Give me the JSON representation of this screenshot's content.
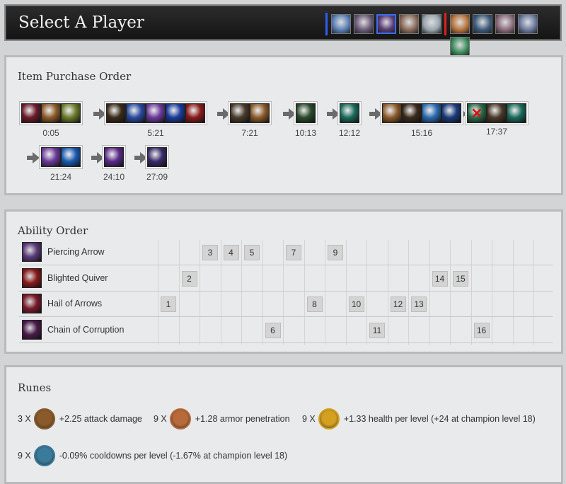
{
  "header": {
    "title": "Select A Player",
    "blue_team": [
      {
        "icon": "champion-portrait-blue-1",
        "color": "#5a7fb8"
      },
      {
        "icon": "champion-portrait-blue-2",
        "color": "#6a5a78"
      },
      {
        "icon": "champion-portrait-blue-3",
        "color": "#5a3d7a",
        "selected": true
      },
      {
        "icon": "champion-portrait-blue-4",
        "color": "#8a6a5a"
      },
      {
        "icon": "champion-portrait-blue-5",
        "color": "#9aa6b0"
      }
    ],
    "red_team": [
      {
        "icon": "champion-portrait-red-1",
        "color": "#b8723a"
      },
      {
        "icon": "champion-portrait-red-2",
        "color": "#3a5a7a"
      },
      {
        "icon": "champion-portrait-red-3",
        "color": "#8a6a7a"
      },
      {
        "icon": "champion-portrait-red-4",
        "color": "#6a7aa0"
      },
      {
        "icon": "champion-portrait-red-5",
        "color": "#3a8a5a"
      }
    ]
  },
  "items": {
    "title": "Item Purchase Order",
    "groups": [
      {
        "time": "0:05",
        "items": [
          "#6a1a2a",
          "#8a5a2a",
          "#6a7a2a"
        ]
      },
      {
        "time": "5:21",
        "items": [
          "#3a2a1a",
          "#2a4aa0",
          "#6a3a9a",
          "#1a3a9a",
          "#8a1a1a"
        ]
      },
      {
        "time": "7:21",
        "items": [
          "#4a3a2a",
          "#8a5a2a"
        ]
      },
      {
        "time": "10:13",
        "items": [
          "#2a4a2a"
        ]
      },
      {
        "time": "12:12",
        "items": [
          "#1a6a5a"
        ]
      },
      {
        "time": "15:16",
        "items": [
          "#8a5a2a",
          "#3a2a1a",
          "#2a6ab0",
          "#1a3a7a"
        ]
      },
      {
        "time": "17:37",
        "items": [
          "#2a6a4a",
          "#4a3a2a",
          "#1a6a5a"
        ]
      },
      {
        "time": "21:24",
        "items": [
          "#6a3a9a",
          "#1a5ab0"
        ]
      },
      {
        "time": "24:10",
        "items": [
          "#5a2a8a"
        ]
      },
      {
        "time": "27:09",
        "items": [
          "#3a2a6a"
        ]
      }
    ]
  },
  "abilities": {
    "title": "Ability Order",
    "rows": [
      {
        "name": "Piercing Arrow",
        "color": "#5a3a7a",
        "levels": [
          {
            "col": 3,
            "lvl": "3"
          },
          {
            "col": 4,
            "lvl": "4"
          },
          {
            "col": 5,
            "lvl": "5"
          },
          {
            "col": 7,
            "lvl": "7"
          },
          {
            "col": 9,
            "lvl": "9"
          }
        ]
      },
      {
        "name": "Blighted Quiver",
        "color": "#8a1a1a",
        "levels": [
          {
            "col": 2,
            "lvl": "2"
          },
          {
            "col": 14,
            "lvl": "14"
          },
          {
            "col": 15,
            "lvl": "15"
          }
        ]
      },
      {
        "name": "Hail of Arrows",
        "color": "#7a1a2a",
        "levels": [
          {
            "col": 1,
            "lvl": "1"
          },
          {
            "col": 8,
            "lvl": "8"
          },
          {
            "col": 10,
            "lvl": "10"
          },
          {
            "col": 12,
            "lvl": "12"
          },
          {
            "col": 13,
            "lvl": "13"
          }
        ]
      },
      {
        "name": "Chain of Corruption",
        "color": "#4a1a4a",
        "levels": [
          {
            "col": 6,
            "lvl": "6"
          },
          {
            "col": 11,
            "lvl": "11"
          },
          {
            "col": 16,
            "lvl": "16"
          }
        ]
      }
    ]
  },
  "runes": {
    "title": "Runes",
    "list": [
      {
        "count": "3 X",
        "text": "+2.25 attack damage",
        "icon": "mark-rune-icon",
        "color": "#8a5a2a"
      },
      {
        "count": "9 X",
        "text": "+1.28 armor penetration",
        "icon": "seal-rune-icon",
        "color": "#b86a3a"
      },
      {
        "count": "9 X",
        "text": "+1.33 health per level (+24 at champion level 18)",
        "icon": "glyph-rune-icon",
        "color": "#d4a020"
      },
      {
        "count": "9 X",
        "text": "-0.09% cooldowns per level (-1.67% at champion level 18)",
        "icon": "quintessence-rune-icon",
        "color": "#3a7a9a"
      }
    ]
  }
}
